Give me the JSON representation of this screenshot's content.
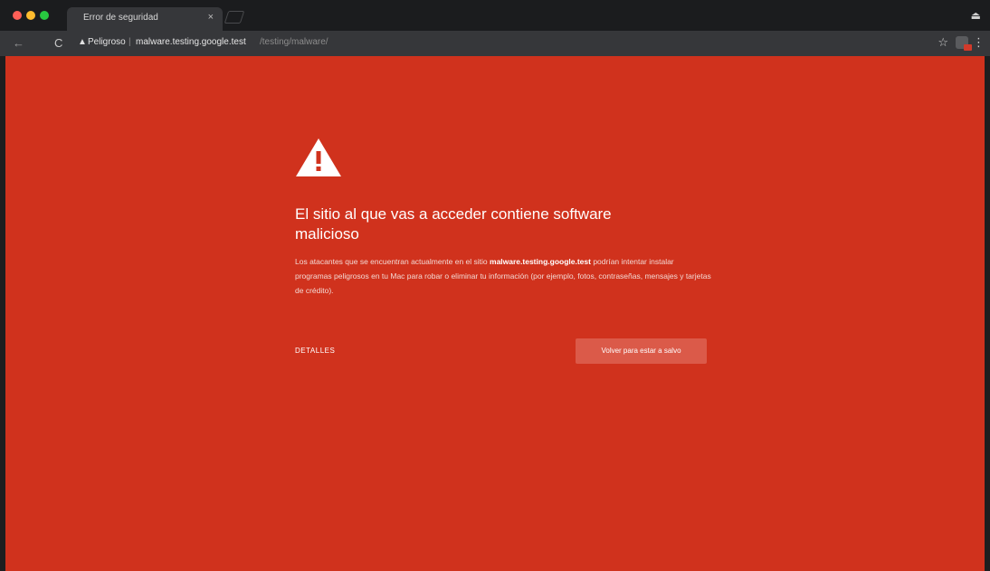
{
  "browser": {
    "tab": {
      "title": "Error de seguridad",
      "close": "×"
    },
    "address_bar": {
      "security_label": "Peligroso",
      "separator": "|",
      "url_host": "malware.testing.google.test",
      "url_path": "/testing/malware/"
    },
    "icons": {
      "back": "←",
      "reload": "C",
      "warning": "▲",
      "star": "☆",
      "menu": "⋮",
      "profile": "⏏"
    }
  },
  "interstitial": {
    "background_color": "#d0321d",
    "heading": "El sitio al que vas a acceder contiene software malicioso",
    "body_prefix": "Los atacantes que se encuentran actualmente en el sitio ",
    "body_host": "malware.testing.google.test",
    "body_suffix": " podrían intentar instalar programas peligrosos en tu Mac para robar o eliminar tu información (por ejemplo, fotos, contraseñas, mensajes y tarjetas de crédito).",
    "details_label": "DETALLES",
    "back_button_label": "Volver para estar a salvo"
  }
}
